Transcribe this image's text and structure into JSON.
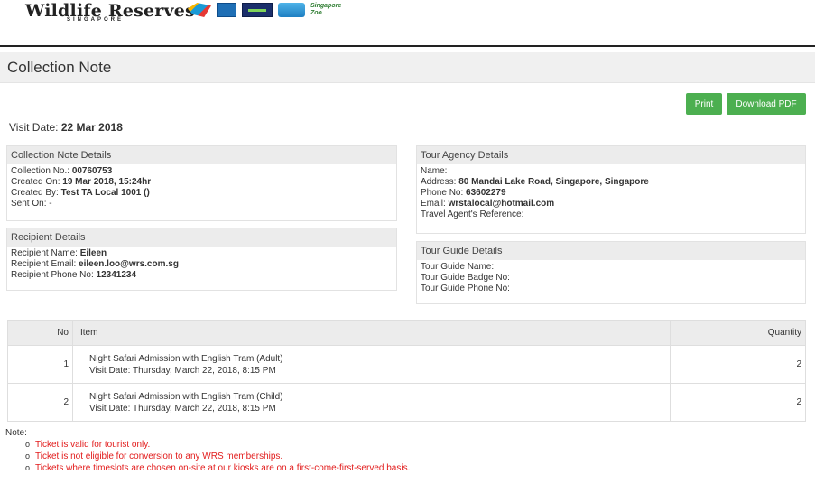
{
  "header": {
    "brand_name": "Wildlife Reserves",
    "brand_sub": "SINGAPORE",
    "logo_zoo_text": "Singapore Zoo",
    "colors": {
      "button": "#4caf50",
      "note_red": "#e21b1b"
    }
  },
  "page": {
    "title": "Collection Note"
  },
  "actions": {
    "print_label": "Print",
    "pdf_label": "Download PDF"
  },
  "visit": {
    "label": "Visit Date:",
    "value": "22 Mar 2018"
  },
  "collection": {
    "title": "Collection Note Details",
    "no_label": "Collection No.:",
    "no_value": "00760753",
    "created_on_label": "Created On:",
    "created_on_value": "19 Mar 2018, 15:24hr",
    "created_by_label": "Created By:",
    "created_by_value": "Test TA Local 1001 ()",
    "sent_on_label": "Sent On:",
    "sent_on_value": "-"
  },
  "recipient": {
    "title": "Recipient Details",
    "name_label": "Recipient Name:",
    "name_value": "Eileen",
    "email_label": "Recipient Email:",
    "email_value": "eileen.loo@wrs.com.sg",
    "phone_label": "Recipient Phone No:",
    "phone_value": "12341234"
  },
  "agency": {
    "title": "Tour Agency Details",
    "name_label": "Name:",
    "address_label": "Address:",
    "address_value": "80 Mandai Lake Road, Singapore, Singapore",
    "phone_label": "Phone No:",
    "phone_value": "63602279",
    "email_label": "Email:",
    "email_value": "wrstalocal@hotmail.com",
    "ref_label": "Travel Agent's Reference:"
  },
  "guide": {
    "title": "Tour Guide Details",
    "name_label": "Tour Guide Name:",
    "badge_label": "Tour Guide Badge No:",
    "phone_label": "Tour Guide Phone No:"
  },
  "table": {
    "col_no": "No",
    "col_item": "Item",
    "col_qty": "Quantity",
    "rows": [
      {
        "no": "1",
        "name": "Night Safari Admission with English Tram (Adult)",
        "date": "Visit Date: Thursday, March 22, 2018, 8:15 PM",
        "qty": "2"
      },
      {
        "no": "2",
        "name": "Night Safari Admission with English Tram (Child)",
        "date": "Visit Date: Thursday, March 22, 2018, 8:15 PM",
        "qty": "2"
      }
    ]
  },
  "notes": {
    "label": "Note:",
    "items": [
      "Ticket is valid for tourist only.",
      "Ticket is not eligible for conversion to any WRS memberships.",
      "Tickets where timeslots are chosen on-site at our kiosks are on a first-come-first-served basis."
    ]
  }
}
